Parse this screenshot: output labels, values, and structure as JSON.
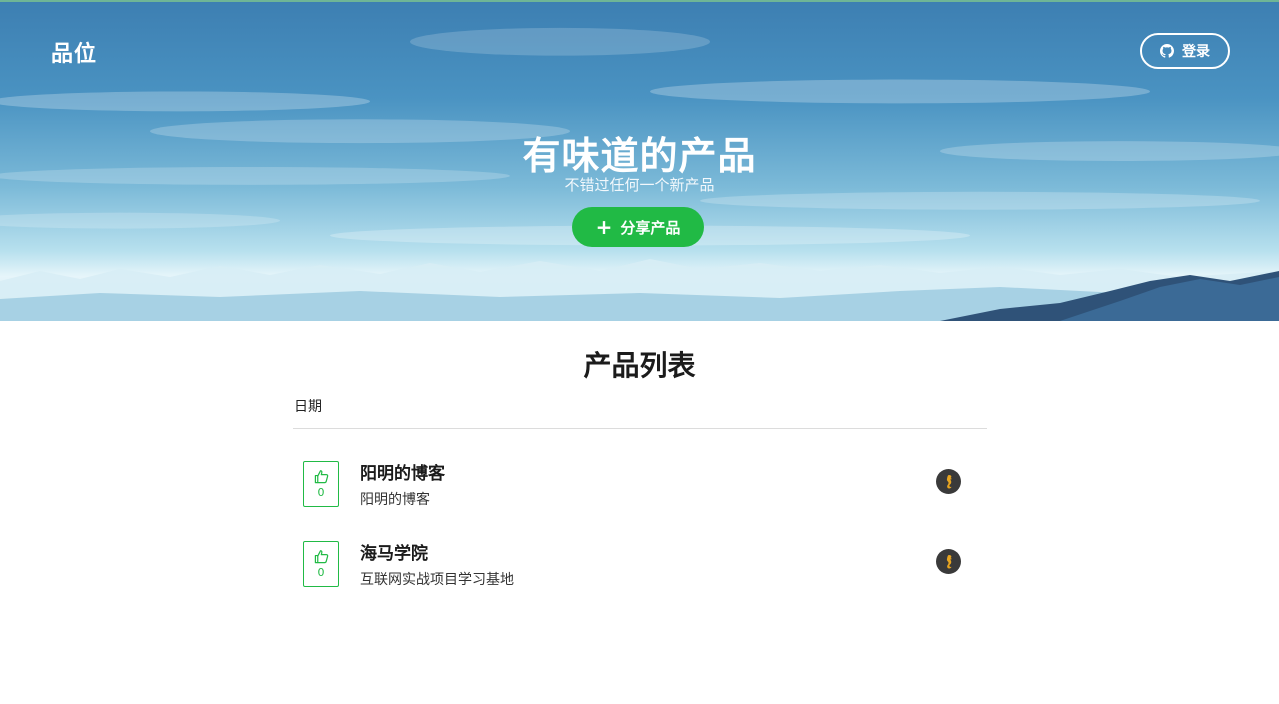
{
  "header": {
    "brand": "品位",
    "login_label": "登录"
  },
  "hero": {
    "title": "有味道的产品",
    "subtitle": "不错过任何一个新产品",
    "share_label": "分享产品"
  },
  "main": {
    "title": "产品列表",
    "filter_label": "日期"
  },
  "products": [
    {
      "name": "阳明的博客",
      "description": "阳明的博客",
      "votes": "0"
    },
    {
      "name": "海马学院",
      "description": "互联网实战项目学习基地",
      "votes": "0"
    }
  ],
  "colors": {
    "accent": "#21ba45",
    "avatar_bg": "#3a3a3a",
    "avatar_fg": "#e8a520"
  },
  "icons": {
    "login": "github-icon",
    "share": "plus-icon",
    "vote": "thumbs-up-icon"
  }
}
